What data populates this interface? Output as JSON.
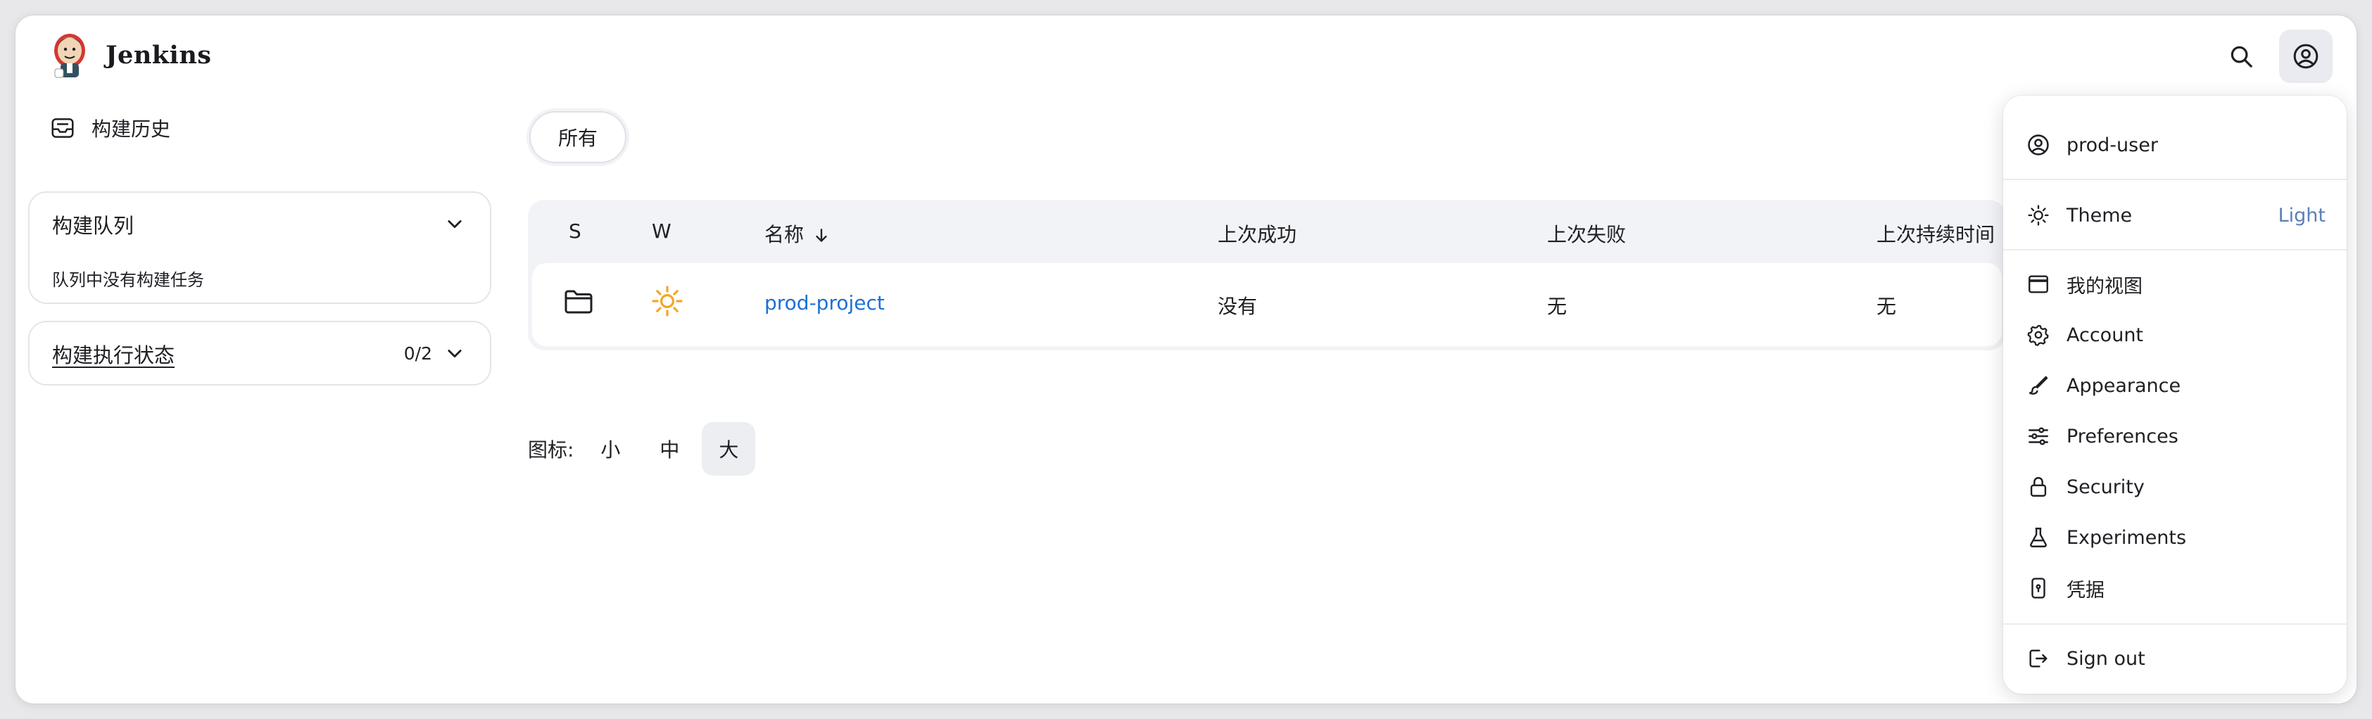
{
  "header": {
    "brand": "Jenkins",
    "search_icon": "search-icon",
    "user_icon": "user-circle-icon"
  },
  "sidebar": {
    "history_label": "构建历史",
    "queue": {
      "title": "构建队列",
      "empty_text": "队列中没有构建任务"
    },
    "executors": {
      "title": "构建执行状态",
      "count": "0/2"
    }
  },
  "tabs": [
    {
      "label": "所有",
      "active": true
    }
  ],
  "table": {
    "columns": [
      "S",
      "W",
      "名称",
      "上次成功",
      "上次失败",
      "上次持续时间"
    ],
    "sorted_column": "名称",
    "rows": [
      {
        "status_icon": "folder-icon",
        "weather_icon": "sun-icon",
        "name": "prod-project",
        "last_success": "没有",
        "last_failure": "无",
        "last_duration": "无"
      }
    ]
  },
  "icon_size": {
    "label": "图标:",
    "options": [
      "小",
      "中",
      "大"
    ],
    "selected": "大"
  },
  "user_menu": {
    "username": "prod-user",
    "theme_label": "Theme",
    "theme_value": "Light",
    "items": [
      {
        "label": "我的视图",
        "icon": "window-icon"
      },
      {
        "label": "Account",
        "icon": "gear-icon"
      },
      {
        "label": "Appearance",
        "icon": "brush-icon"
      },
      {
        "label": "Preferences",
        "icon": "sliders-icon"
      },
      {
        "label": "Security",
        "icon": "lock-icon"
      },
      {
        "label": "Experiments",
        "icon": "flask-icon"
      },
      {
        "label": "凭据",
        "icon": "phone-key-icon"
      }
    ],
    "sign_out": "Sign out"
  },
  "colors": {
    "link": "#1e6fd6",
    "sun": "#f5a623",
    "theme_value": "#5b7fb8"
  }
}
